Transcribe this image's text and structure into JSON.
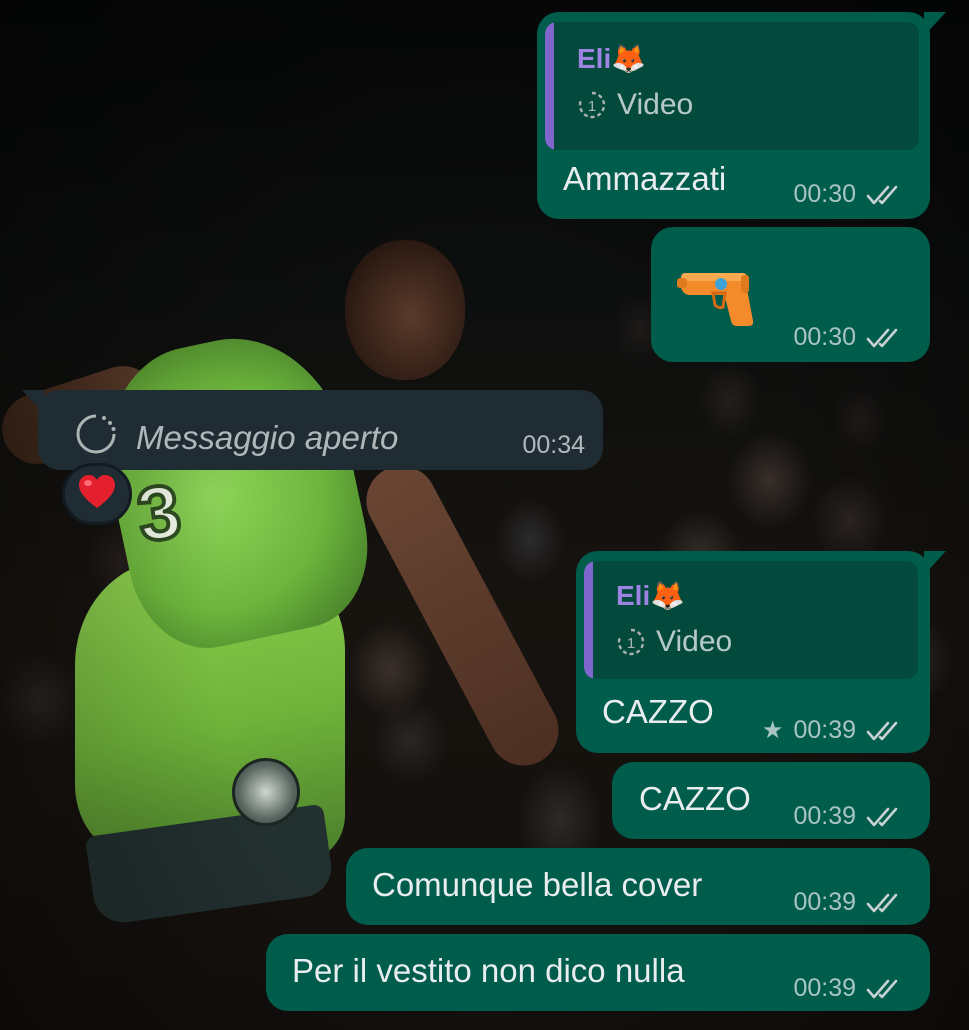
{
  "messages": [
    {
      "quote": {
        "author": "Eli🦊",
        "media_label": "Video",
        "media_icon": "view-once-icon"
      },
      "text": "Ammazzati",
      "time": "00:30",
      "status": "read"
    },
    {
      "emoji": "water-pistol",
      "time": "00:30",
      "status": "read"
    },
    {
      "text": "Messaggio aperto",
      "time": "00:34",
      "icon": "view-once-opened-icon",
      "reaction": "❤️"
    },
    {
      "quote": {
        "author": "Eli🦊",
        "media_label": "Video",
        "media_icon": "view-once-icon"
      },
      "text": "CAZZO",
      "star": "★",
      "time": "00:39",
      "status": "read"
    },
    {
      "text": "CAZZO",
      "time": "00:39",
      "status": "read"
    },
    {
      "text": "Comunque bella cover",
      "time": "00:39",
      "status": "read"
    },
    {
      "text": "Per il vestito non dico nulla",
      "time": "00:39",
      "status": "read"
    }
  ],
  "colors": {
    "outgoing_bubble": "#005c4b",
    "incoming_bubble": "#1f2c33",
    "quote_accent": "#7f66cf",
    "read_ticks": "#e9edef"
  }
}
